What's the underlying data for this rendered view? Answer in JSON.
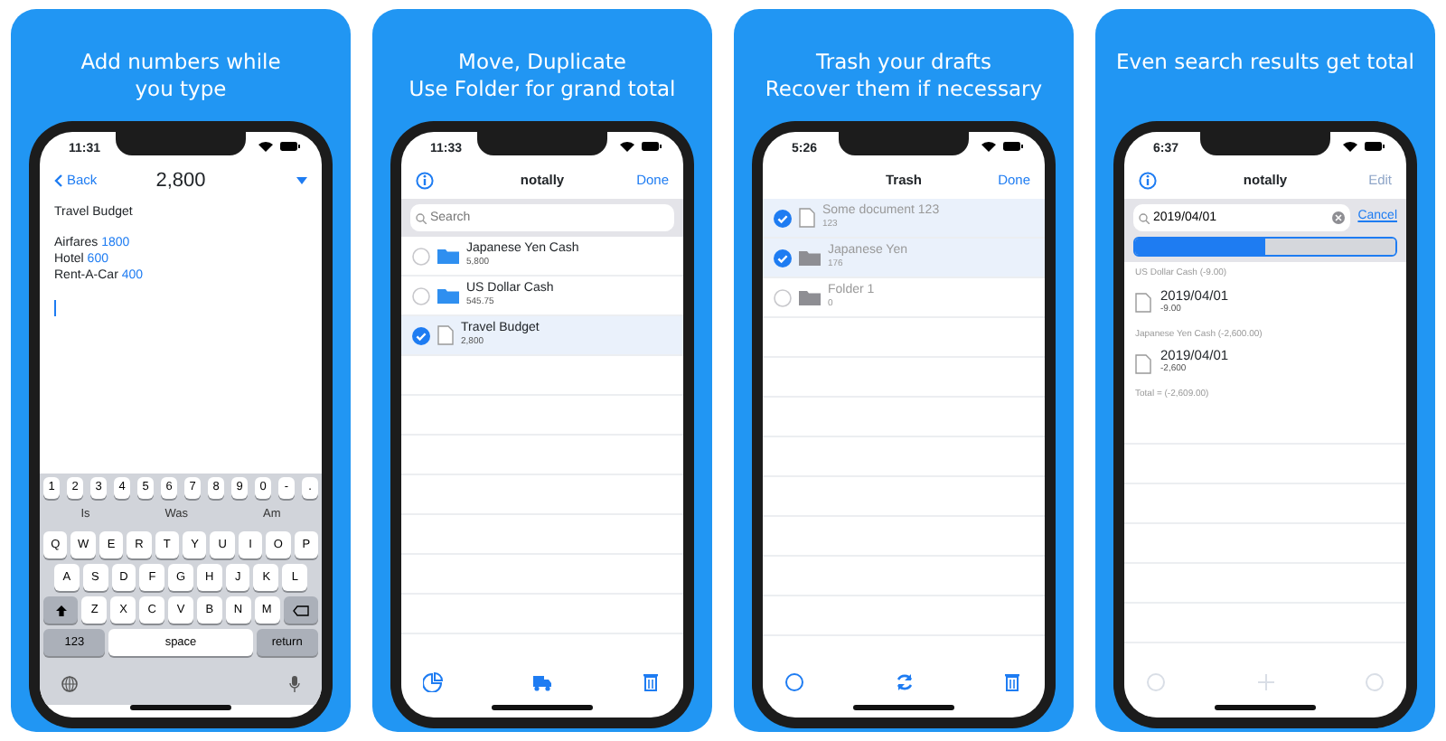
{
  "panels": [
    {
      "kind": "editor",
      "headline": [
        "Add numbers while",
        "you type"
      ],
      "time": "11:31",
      "back": "Back",
      "total": "2,800",
      "note_title": "Travel Budget",
      "lines": [
        {
          "label": "Airfares",
          "amount": "1800"
        },
        {
          "label": "Hotel",
          "amount": "600"
        },
        {
          "label": "Rent-A-Car",
          "amount": "400"
        }
      ],
      "keyboard": {
        "number_row": [
          "1",
          "2",
          "3",
          "4",
          "5",
          "6",
          "7",
          "8",
          "9",
          "0",
          "-",
          "."
        ],
        "suggestions": [
          "Is",
          "Was",
          "Am"
        ],
        "rows": [
          [
            "Q",
            "W",
            "E",
            "R",
            "T",
            "Y",
            "U",
            "I",
            "O",
            "P"
          ],
          [
            "A",
            "S",
            "D",
            "F",
            "G",
            "H",
            "J",
            "K",
            "L"
          ],
          [
            "Z",
            "X",
            "C",
            "V",
            "B",
            "N",
            "M"
          ]
        ],
        "mode_key": "123",
        "space_key": "space",
        "return_key": "return"
      }
    },
    {
      "kind": "list",
      "headline": [
        "Move, Duplicate",
        "Use Folder for grand total"
      ],
      "time": "11:33",
      "info": true,
      "title": "notally",
      "action": {
        "label": "Done",
        "disabled": false
      },
      "search": {
        "placeholder": "Search"
      },
      "greyed": false,
      "rows": [
        {
          "kind": "folder",
          "name": "Japanese Yen Cash",
          "detail": "5,800",
          "selected": false
        },
        {
          "kind": "folder",
          "name": "US Dollar Cash",
          "detail": "545.75",
          "selected": false
        },
        {
          "kind": "document",
          "name": "Travel Budget",
          "detail": "2,800",
          "selected": true
        }
      ],
      "toolbar": [
        {
          "disabled": false
        },
        {
          "disabled": false
        },
        {
          "disabled": false
        }
      ]
    },
    {
      "kind": "list",
      "headline": [
        "Trash your drafts",
        "Recover them if necessary"
      ],
      "time": "5:26",
      "info": false,
      "title": "Trash",
      "action": {
        "label": "Done",
        "disabled": false
      },
      "greyed": true,
      "rows": [
        {
          "kind": "document",
          "name": "Some document 123",
          "detail": "123",
          "selected": true
        },
        {
          "kind": "folder",
          "name": "Japanese Yen",
          "detail": "176",
          "selected": true
        },
        {
          "kind": "folder",
          "name": "Folder 1",
          "detail": "0",
          "selected": false
        }
      ],
      "toolbar": [
        {
          "disabled": false
        },
        {
          "disabled": false
        },
        {
          "disabled": false
        }
      ]
    },
    {
      "kind": "search",
      "headline": [
        "Even search results get total"
      ],
      "time": "6:37",
      "info": true,
      "title": "notally",
      "action": {
        "label": "Edit",
        "disabled": true
      },
      "search": {
        "value": "2019/04/01",
        "cancel": "Cancel"
      },
      "segments": [
        {
          "selected": true
        },
        {
          "selected": false
        }
      ],
      "sections": [
        {
          "header": "US Dollar Cash (-9.00)",
          "results": [
            {
              "name": "2019/04/01",
              "detail": "-9.00"
            }
          ]
        },
        {
          "header": "Japanese Yen Cash (-2,600.00)",
          "results": [
            {
              "name": "2019/04/01",
              "detail": "-2,600"
            }
          ]
        }
      ],
      "footer": "Total = (-2,609.00)",
      "toolbar": [
        {
          "disabled": true
        },
        {
          "disabled": true
        },
        {
          "disabled": true
        }
      ]
    }
  ]
}
